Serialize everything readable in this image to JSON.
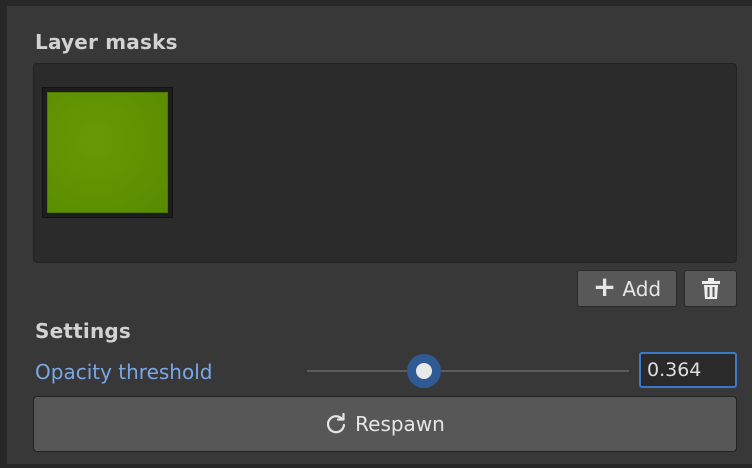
{
  "layer_masks": {
    "title": "Layer masks",
    "items": [
      {
        "color": "#5f9202"
      }
    ],
    "add_label": "Add",
    "add_icon": "plus-icon",
    "delete_icon": "trash-icon"
  },
  "settings": {
    "title": "Settings",
    "opacity_threshold": {
      "label": "Opacity threshold",
      "value": "0.364",
      "slider_fraction": 0.364
    },
    "respawn_label": "Respawn",
    "respawn_icon": "refresh-icon"
  },
  "colors": {
    "accent": "#3a79c9",
    "label_blue": "#7aa7e8",
    "panel": "#383838"
  }
}
